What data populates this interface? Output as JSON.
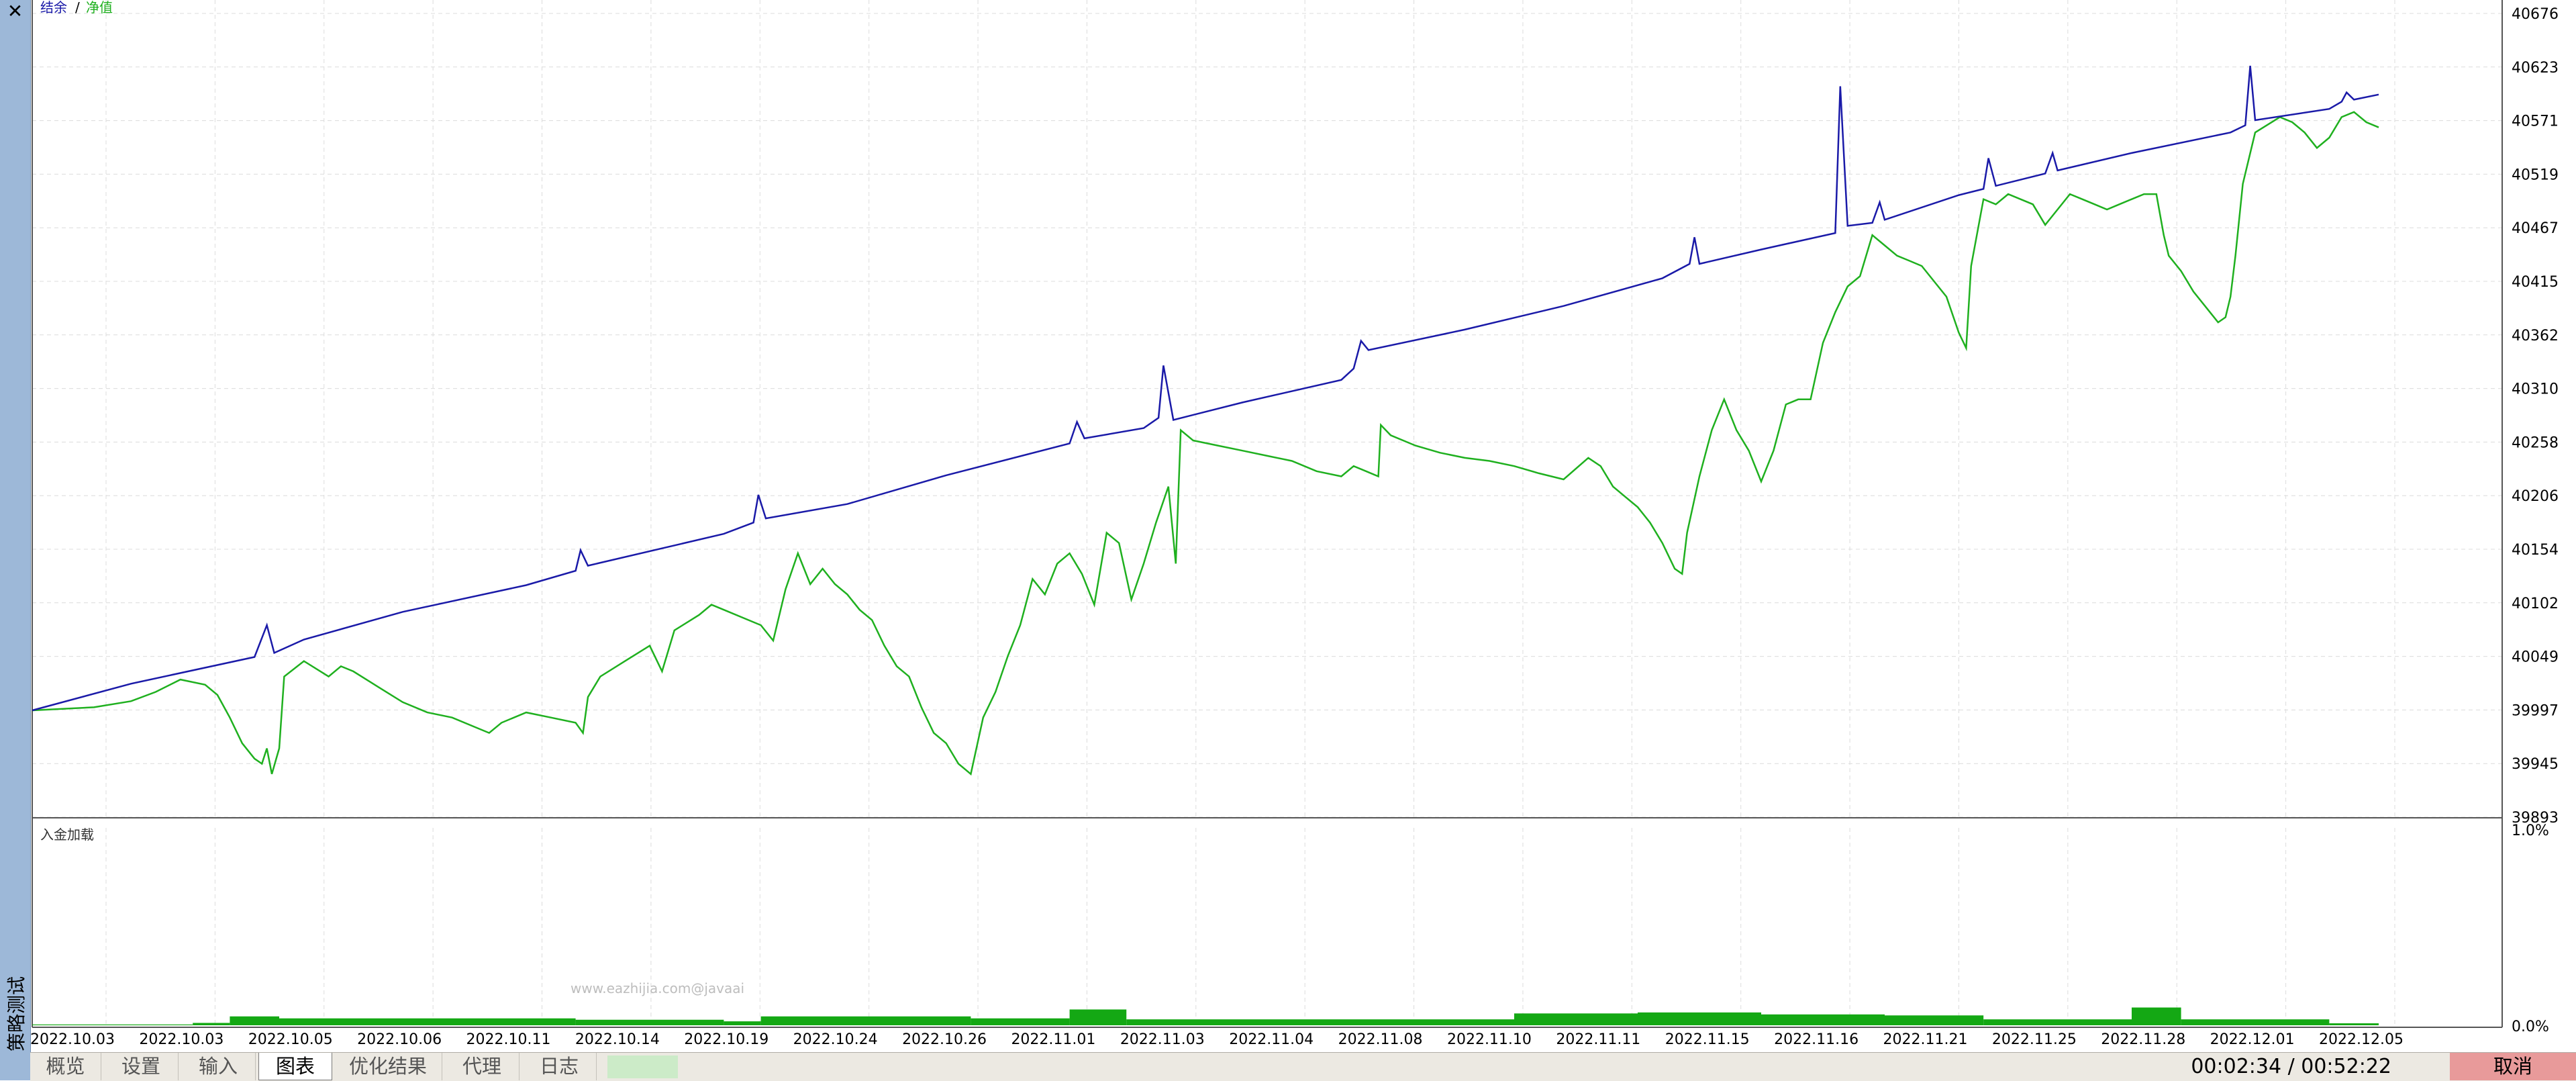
{
  "sidebar": {
    "title": "策略测试",
    "close_symbol": "✕"
  },
  "legend": {
    "balance": "结余",
    "separator": "/",
    "equity": "净值"
  },
  "subchart": {
    "title": "入金加载",
    "y_top": "1.0%",
    "y_bottom": "0.0%"
  },
  "watermark": "www.eazhijia.com@javaai",
  "tabs": [
    {
      "label": "概览"
    },
    {
      "label": "设置"
    },
    {
      "label": "输入"
    },
    {
      "label": "图表",
      "active": true
    },
    {
      "label": "优化结果"
    },
    {
      "label": "代理"
    },
    {
      "label": "日志"
    }
  ],
  "status": {
    "timer": "00:02:34 / 00:52:22",
    "cancel_label": "取消"
  },
  "colors": {
    "balance": "#1a1aa8",
    "equity": "#1fb01f",
    "load": "#14a814",
    "sidebar": "#9db8d8",
    "cancel": "#e89a9a"
  },
  "chart_data": {
    "type": "line",
    "x_tick_labels": [
      "2022.10.03",
      "2022.10.03",
      "2022.10.05",
      "2022.10.06",
      "2022.10.11",
      "2022.10.14",
      "2022.10.19",
      "2022.10.24",
      "2022.10.26",
      "2022.11.01",
      "2022.11.03",
      "2022.11.04",
      "2022.11.08",
      "2022.11.10",
      "2022.11.11",
      "2022.11.15",
      "2022.11.16",
      "2022.11.21",
      "2022.11.25",
      "2022.11.28",
      "2022.12.01",
      "2022.12.05"
    ],
    "y_tick_labels": [
      "40676",
      "40623",
      "40571",
      "40519",
      "40467",
      "40415",
      "40362",
      "40310",
      "40258",
      "40206",
      "40154",
      "40102",
      "40049",
      "39997",
      "39945",
      "39893"
    ],
    "ylim": [
      39893,
      40676
    ],
    "x_range": [
      0,
      1
    ],
    "series": [
      {
        "name": "结余",
        "points": [
          [
            0,
            39997
          ],
          [
            0.04,
            40023
          ],
          [
            0.09,
            40049
          ],
          [
            0.095,
            40080
          ],
          [
            0.098,
            40053
          ],
          [
            0.11,
            40066
          ],
          [
            0.15,
            40093
          ],
          [
            0.2,
            40119
          ],
          [
            0.22,
            40133
          ],
          [
            0.222,
            40153
          ],
          [
            0.225,
            40138
          ],
          [
            0.28,
            40169
          ],
          [
            0.292,
            40180
          ],
          [
            0.294,
            40207
          ],
          [
            0.297,
            40184
          ],
          [
            0.33,
            40198
          ],
          [
            0.37,
            40226
          ],
          [
            0.42,
            40257
          ],
          [
            0.423,
            40278
          ],
          [
            0.426,
            40262
          ],
          [
            0.45,
            40272
          ],
          [
            0.456,
            40282
          ],
          [
            0.458,
            40333
          ],
          [
            0.462,
            40280
          ],
          [
            0.49,
            40297
          ],
          [
            0.53,
            40319
          ],
          [
            0.535,
            40330
          ],
          [
            0.538,
            40357
          ],
          [
            0.541,
            40348
          ],
          [
            0.58,
            40368
          ],
          [
            0.62,
            40391
          ],
          [
            0.66,
            40418
          ],
          [
            0.671,
            40432
          ],
          [
            0.673,
            40458
          ],
          [
            0.675,
            40432
          ],
          [
            0.7,
            40446
          ],
          [
            0.73,
            40462
          ],
          [
            0.732,
            40605
          ],
          [
            0.735,
            40469
          ],
          [
            0.745,
            40472
          ],
          [
            0.748,
            40492
          ],
          [
            0.75,
            40475
          ],
          [
            0.78,
            40499
          ],
          [
            0.79,
            40505
          ],
          [
            0.792,
            40535
          ],
          [
            0.795,
            40508
          ],
          [
            0.815,
            40520
          ],
          [
            0.818,
            40540
          ],
          [
            0.82,
            40523
          ],
          [
            0.85,
            40540
          ],
          [
            0.89,
            40560
          ],
          [
            0.896,
            40567
          ],
          [
            0.898,
            40625
          ],
          [
            0.9,
            40572
          ],
          [
            0.93,
            40583
          ],
          [
            0.935,
            40590
          ],
          [
            0.937,
            40599
          ],
          [
            0.94,
            40592
          ],
          [
            0.95,
            40597
          ]
        ]
      },
      {
        "name": "净值",
        "points": [
          [
            0,
            39997
          ],
          [
            0.025,
            40000
          ],
          [
            0.04,
            40006
          ],
          [
            0.05,
            40015
          ],
          [
            0.06,
            40027
          ],
          [
            0.07,
            40022
          ],
          [
            0.075,
            40012
          ],
          [
            0.08,
            39990
          ],
          [
            0.085,
            39965
          ],
          [
            0.09,
            39950
          ],
          [
            0.093,
            39945
          ],
          [
            0.095,
            39960
          ],
          [
            0.097,
            39935
          ],
          [
            0.1,
            39960
          ],
          [
            0.102,
            40030
          ],
          [
            0.11,
            40045
          ],
          [
            0.12,
            40030
          ],
          [
            0.125,
            40040
          ],
          [
            0.13,
            40035
          ],
          [
            0.14,
            40020
          ],
          [
            0.15,
            40005
          ],
          [
            0.16,
            39995
          ],
          [
            0.17,
            39990
          ],
          [
            0.18,
            39980
          ],
          [
            0.185,
            39975
          ],
          [
            0.19,
            39985
          ],
          [
            0.2,
            39995
          ],
          [
            0.21,
            39990
          ],
          [
            0.22,
            39985
          ],
          [
            0.223,
            39975
          ],
          [
            0.225,
            40010
          ],
          [
            0.23,
            40030
          ],
          [
            0.24,
            40045
          ],
          [
            0.25,
            40060
          ],
          [
            0.255,
            40035
          ],
          [
            0.26,
            40075
          ],
          [
            0.27,
            40090
          ],
          [
            0.275,
            40100
          ],
          [
            0.28,
            40095
          ],
          [
            0.29,
            40085
          ],
          [
            0.295,
            40080
          ],
          [
            0.3,
            40065
          ],
          [
            0.305,
            40115
          ],
          [
            0.31,
            40150
          ],
          [
            0.315,
            40120
          ],
          [
            0.32,
            40135
          ],
          [
            0.325,
            40120
          ],
          [
            0.33,
            40110
          ],
          [
            0.335,
            40095
          ],
          [
            0.34,
            40085
          ],
          [
            0.345,
            40060
          ],
          [
            0.35,
            40040
          ],
          [
            0.355,
            40030
          ],
          [
            0.36,
            40000
          ],
          [
            0.365,
            39975
          ],
          [
            0.37,
            39965
          ],
          [
            0.375,
            39945
          ],
          [
            0.38,
            39935
          ],
          [
            0.385,
            39990
          ],
          [
            0.39,
            40015
          ],
          [
            0.395,
            40050
          ],
          [
            0.4,
            40080
          ],
          [
            0.405,
            40125
          ],
          [
            0.41,
            40110
          ],
          [
            0.415,
            40140
          ],
          [
            0.42,
            40150
          ],
          [
            0.425,
            40130
          ],
          [
            0.43,
            40100
          ],
          [
            0.435,
            40170
          ],
          [
            0.44,
            40160
          ],
          [
            0.445,
            40105
          ],
          [
            0.45,
            40140
          ],
          [
            0.455,
            40180
          ],
          [
            0.46,
            40215
          ],
          [
            0.463,
            40140
          ],
          [
            0.465,
            40270
          ],
          [
            0.47,
            40260
          ],
          [
            0.48,
            40255
          ],
          [
            0.49,
            40250
          ],
          [
            0.5,
            40245
          ],
          [
            0.51,
            40240
          ],
          [
            0.52,
            40230
          ],
          [
            0.53,
            40225
          ],
          [
            0.535,
            40235
          ],
          [
            0.54,
            40230
          ],
          [
            0.545,
            40225
          ],
          [
            0.546,
            40275
          ],
          [
            0.55,
            40265
          ],
          [
            0.56,
            40255
          ],
          [
            0.57,
            40248
          ],
          [
            0.58,
            40243
          ],
          [
            0.59,
            40240
          ],
          [
            0.6,
            40235
          ],
          [
            0.61,
            40228
          ],
          [
            0.62,
            40222
          ],
          [
            0.63,
            40243
          ],
          [
            0.635,
            40235
          ],
          [
            0.64,
            40215
          ],
          [
            0.65,
            40195
          ],
          [
            0.655,
            40180
          ],
          [
            0.66,
            40160
          ],
          [
            0.665,
            40135
          ],
          [
            0.668,
            40130
          ],
          [
            0.67,
            40170
          ],
          [
            0.675,
            40225
          ],
          [
            0.68,
            40270
          ],
          [
            0.685,
            40300
          ],
          [
            0.69,
            40270
          ],
          [
            0.695,
            40250
          ],
          [
            0.7,
            40220
          ],
          [
            0.705,
            40250
          ],
          [
            0.71,
            40295
          ],
          [
            0.715,
            40300
          ],
          [
            0.72,
            40300
          ],
          [
            0.725,
            40355
          ],
          [
            0.73,
            40385
          ],
          [
            0.735,
            40410
          ],
          [
            0.74,
            40420
          ],
          [
            0.745,
            40460
          ],
          [
            0.75,
            40450
          ],
          [
            0.755,
            40440
          ],
          [
            0.76,
            40435
          ],
          [
            0.765,
            40430
          ],
          [
            0.77,
            40415
          ],
          [
            0.775,
            40400
          ],
          [
            0.78,
            40365
          ],
          [
            0.783,
            40350
          ],
          [
            0.785,
            40430
          ],
          [
            0.79,
            40495
          ],
          [
            0.795,
            40490
          ],
          [
            0.8,
            40500
          ],
          [
            0.81,
            40490
          ],
          [
            0.815,
            40470
          ],
          [
            0.82,
            40485
          ],
          [
            0.825,
            40500
          ],
          [
            0.83,
            40495
          ],
          [
            0.835,
            40490
          ],
          [
            0.84,
            40485
          ],
          [
            0.845,
            40490
          ],
          [
            0.85,
            40495
          ],
          [
            0.855,
            40500
          ],
          [
            0.86,
            40500
          ],
          [
            0.863,
            40460
          ],
          [
            0.865,
            40440
          ],
          [
            0.87,
            40425
          ],
          [
            0.875,
            40405
          ],
          [
            0.88,
            40390
          ],
          [
            0.885,
            40375
          ],
          [
            0.888,
            40380
          ],
          [
            0.89,
            40400
          ],
          [
            0.892,
            40440
          ],
          [
            0.895,
            40510
          ],
          [
            0.9,
            40560
          ],
          [
            0.91,
            40575
          ],
          [
            0.915,
            40570
          ],
          [
            0.92,
            40560
          ],
          [
            0.925,
            40545
          ],
          [
            0.93,
            40555
          ],
          [
            0.935,
            40575
          ],
          [
            0.94,
            40580
          ],
          [
            0.945,
            40570
          ],
          [
            0.95,
            40565
          ]
        ]
      }
    ],
    "subplot_load": {
      "ylim": [
        0,
        1
      ],
      "unit": "%",
      "segments": [
        [
          0.0,
          0.065,
          0.004
        ],
        [
          0.065,
          0.08,
          0.012
        ],
        [
          0.08,
          0.1,
          0.045
        ],
        [
          0.1,
          0.22,
          0.035
        ],
        [
          0.22,
          0.28,
          0.028
        ],
        [
          0.28,
          0.295,
          0.02
        ],
        [
          0.295,
          0.38,
          0.045
        ],
        [
          0.38,
          0.42,
          0.035
        ],
        [
          0.42,
          0.443,
          0.08
        ],
        [
          0.443,
          0.6,
          0.03
        ],
        [
          0.6,
          0.65,
          0.06
        ],
        [
          0.65,
          0.7,
          0.065
        ],
        [
          0.7,
          0.75,
          0.055
        ],
        [
          0.75,
          0.79,
          0.05
        ],
        [
          0.79,
          0.85,
          0.03
        ],
        [
          0.85,
          0.87,
          0.09
        ],
        [
          0.87,
          0.93,
          0.03
        ],
        [
          0.93,
          0.95,
          0.01
        ]
      ]
    }
  }
}
